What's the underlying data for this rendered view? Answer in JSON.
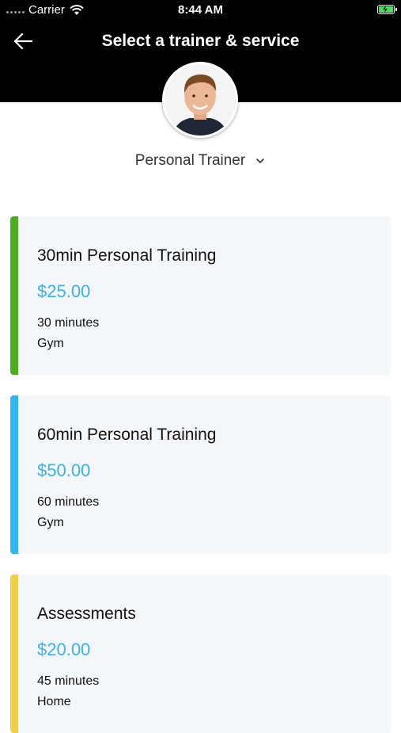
{
  "status_bar": {
    "carrier": "Carrier",
    "time": "8:44 AM"
  },
  "header": {
    "title": "Select a trainer & service",
    "background": "#000000"
  },
  "trainer": {
    "selected": "Personal Trainer"
  },
  "services": [
    {
      "name": "30min Personal Training",
      "price": "$25.00",
      "duration": "30 minutes",
      "location": "Gym",
      "accent": "#4cae1f"
    },
    {
      "name": "60min Personal Training",
      "price": "$50.00",
      "duration": "60 minutes",
      "location": "Gym",
      "accent": "#33b5ef"
    },
    {
      "name": "Assessments",
      "price": "$20.00",
      "duration": "45 minutes",
      "location": "Home",
      "accent": "#f0cf4b"
    }
  ],
  "colors": {
    "price": "#3bb2e8",
    "card_background": "#f3f7fa"
  }
}
